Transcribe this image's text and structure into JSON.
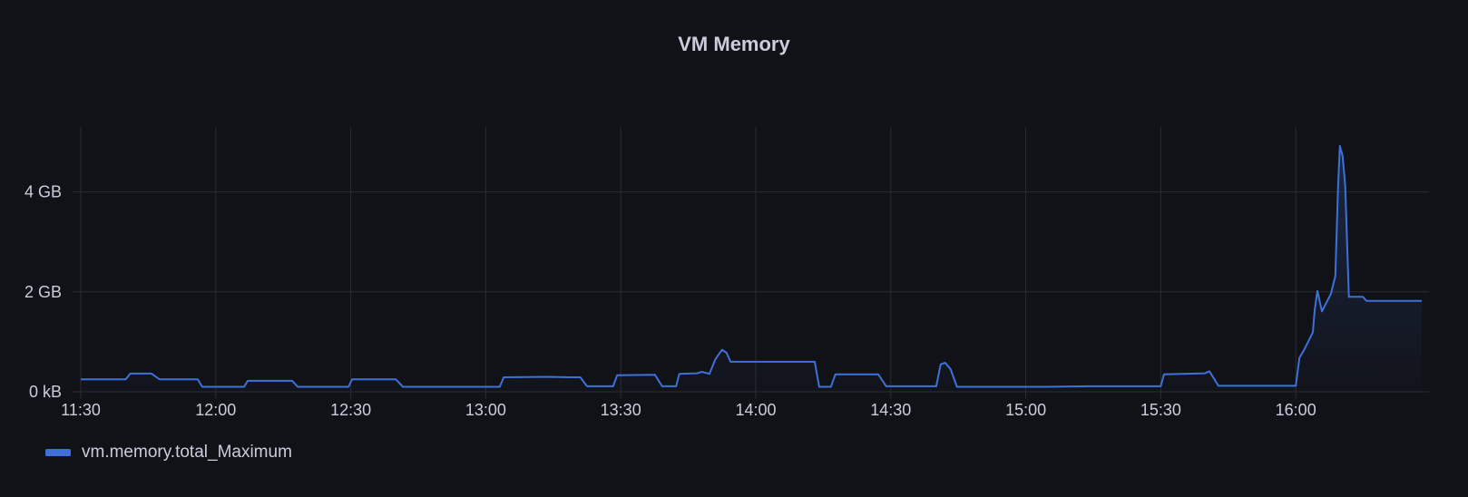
{
  "panel": {
    "title": "VM Memory"
  },
  "colors": {
    "background": "#111217",
    "series": "#3d71d9",
    "grid": "#2a2b31",
    "text": "#ccccdc"
  },
  "chart_data": {
    "type": "line",
    "title": "VM Memory",
    "xlabel": "",
    "ylabel": "",
    "x_unit": "time",
    "y_unit": "GB",
    "xlim": [
      "11:30:00",
      "16:29:36"
    ],
    "ylim": [
      0,
      5.3
    ],
    "grid": true,
    "legend_placement": "bottom-left",
    "x_ticks": [
      "11:30",
      "12:00",
      "12:30",
      "13:00",
      "13:30",
      "14:00",
      "14:30",
      "15:00",
      "15:30",
      "16:00"
    ],
    "y_ticks": [
      {
        "value": 0,
        "label": "0 kB"
      },
      {
        "value": 2,
        "label": "2 GB"
      },
      {
        "value": 4,
        "label": "4 GB"
      }
    ],
    "series": [
      {
        "name": "vm.memory.total_Maximum",
        "x": [
          "11:30:00",
          "11:40:00",
          "11:41:00",
          "11:45:42",
          "11:47:30",
          "11:56:00",
          "11:57:00",
          "12:06:18",
          "12:07:06",
          "12:17:00",
          "12:18:12",
          "12:29:30",
          "12:30:18",
          "12:40:00",
          "12:41:36",
          "13:03:06",
          "13:04:00",
          "13:13:36",
          "13:19:00",
          "13:21:00",
          "13:22:30",
          "13:28:18",
          "13:29:12",
          "13:37:36",
          "13:39:12",
          "13:42:18",
          "13:43:00",
          "13:47:00",
          "13:48:00",
          "13:49:42",
          "13:51:00",
          "13:52:30",
          "13:53:30",
          "13:54:24",
          "14:13:06",
          "14:14:06",
          "14:16:42",
          "14:17:42",
          "14:27:12",
          "14:29:00",
          "14:40:06",
          "14:41:06",
          "14:42:06",
          "14:43:18",
          "14:44:42",
          "15:04:30",
          "15:14:00",
          "15:30:00",
          "15:30:42",
          "15:39:48",
          "15:40:48",
          "15:42:48",
          "16:00:00",
          "16:00:48",
          "16:01:48",
          "16:03:48",
          "16:04:12",
          "16:04:48",
          "16:05:48",
          "16:07:48",
          "16:08:48",
          "16:09:24",
          "16:09:48",
          "16:10:24",
          "16:11:00",
          "16:11:48",
          "16:14:54",
          "16:15:42",
          "16:28:00"
        ],
        "y": [
          0.25,
          0.25,
          0.365,
          0.365,
          0.25,
          0.25,
          0.1,
          0.1,
          0.22,
          0.22,
          0.1,
          0.1,
          0.25,
          0.25,
          0.1,
          0.1,
          0.29,
          0.3,
          0.29,
          0.29,
          0.11,
          0.11,
          0.33,
          0.34,
          0.11,
          0.11,
          0.36,
          0.37,
          0.4,
          0.36,
          0.65,
          0.84,
          0.78,
          0.6,
          0.6,
          0.1,
          0.1,
          0.35,
          0.35,
          0.11,
          0.11,
          0.55,
          0.58,
          0.45,
          0.1,
          0.1,
          0.11,
          0.11,
          0.35,
          0.37,
          0.41,
          0.12,
          0.12,
          0.68,
          0.83,
          1.19,
          1.63,
          2.02,
          1.61,
          1.96,
          2.32,
          4.12,
          4.92,
          4.72,
          4.12,
          1.9,
          1.9,
          1.82,
          1.82
        ]
      }
    ]
  }
}
